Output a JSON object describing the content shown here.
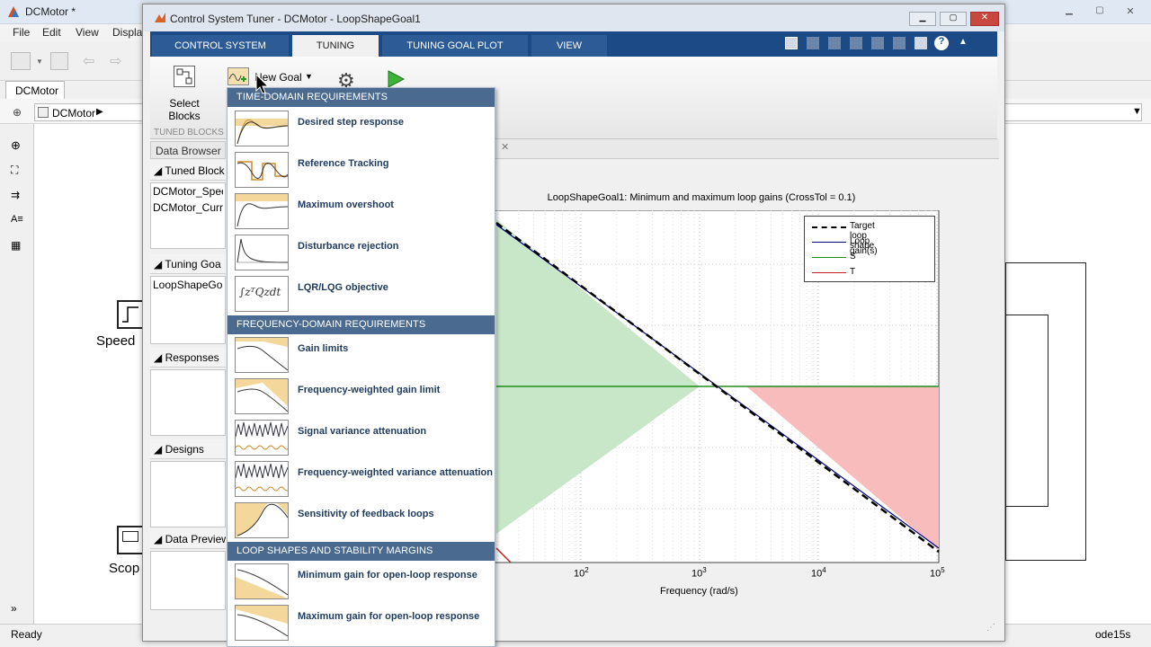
{
  "background_window": {
    "title": "DCMotor *",
    "menu": [
      "File",
      "Edit",
      "View",
      "Displa"
    ],
    "tab": "DCMotor",
    "breadcrumb": "DCMotor",
    "status_left": "Ready",
    "status_right": "ode15s",
    "block_labels": {
      "speed": "Speed",
      "scope": "Scop"
    }
  },
  "tuner": {
    "title": "Control System Tuner - DCMotor - LoopShapeGoal1",
    "tabs": [
      "CONTROL SYSTEM",
      "TUNING",
      "TUNING GOAL PLOT",
      "VIEW"
    ],
    "active_tab": "TUNING",
    "ribbon": {
      "select_blocks_line1": "Select",
      "select_blocks_line2": "Blocks",
      "new_goal": "New Goal",
      "section_label": "TUNED BLOCKS"
    },
    "data_browser": {
      "title": "Data Browser",
      "sections": [
        {
          "label": "Tuned Block",
          "items": [
            "DCMotor_Speed",
            "DCMotor_Curre"
          ]
        },
        {
          "label": "Tuning Goa",
          "items": [
            "LoopShapeGoa"
          ]
        },
        {
          "label": "Responses",
          "items": []
        },
        {
          "label": "Designs",
          "items": []
        },
        {
          "label": "Data Preview",
          "items": []
        }
      ]
    }
  },
  "new_goal_gallery": {
    "groups": [
      {
        "header": "TIME-DOMAIN REQUIREMENTS",
        "items": [
          "Desired step response",
          "Reference Tracking",
          "Maximum overshoot",
          "Disturbance rejection",
          "LQR/LQG objective"
        ]
      },
      {
        "header": "FREQUENCY-DOMAIN REQUIREMENTS",
        "items": [
          "Gain limits",
          "Frequency-weighted gain limit",
          "Signal variance attenuation",
          "Frequency-weighted variance attenuation",
          "Sensitivity of feedback loops"
        ]
      },
      {
        "header": "LOOP SHAPES AND STABILITY MARGINS",
        "items": [
          "Minimum gain for open-loop response",
          "Maximum gain for open-loop response"
        ]
      }
    ],
    "lqr_glyph": "∫zᵀQzdt"
  },
  "plot": {
    "title": "LoopShapeGoal1: Minimum and maximum loop gains (CrossTol = 0.1)",
    "xlabel": "Frequency (rad/s)",
    "x_ticks": [
      "10",
      "10",
      "10",
      "10"
    ],
    "x_tick_exponents": [
      "2",
      "3",
      "4",
      "5"
    ],
    "legend": [
      "Target loop shape",
      "Loop gain(s)",
      "S",
      "T"
    ],
    "colors": {
      "target": "#000000",
      "loop": "#000080",
      "S": "#1e8c1e",
      "T": "#c02020",
      "min_region": "#c8e6c8",
      "max_region": "#f9bcbc"
    }
  }
}
